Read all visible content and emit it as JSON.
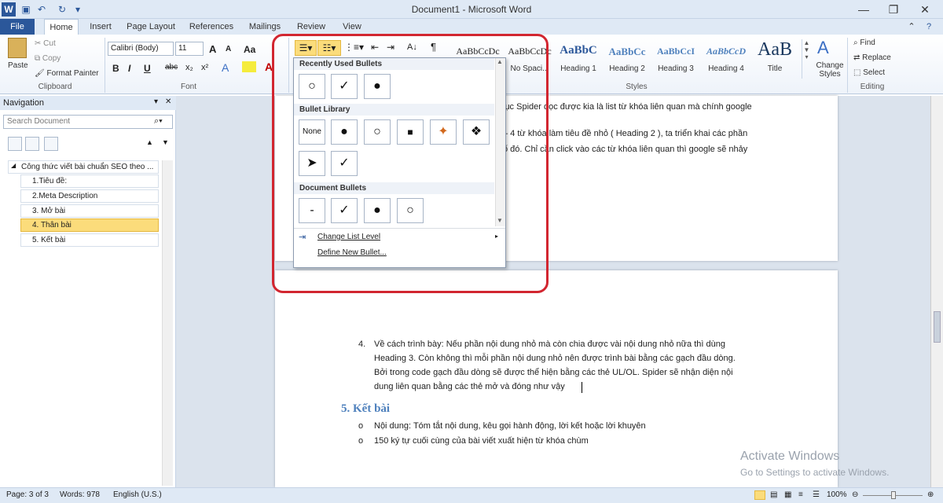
{
  "window": {
    "title": "Document1 - Microsoft Word"
  },
  "tabs": [
    "File",
    "Home",
    "Insert",
    "Page Layout",
    "References",
    "Mailings",
    "Review",
    "View"
  ],
  "clipboard": {
    "group_label": "Clipboard",
    "paste": "Paste",
    "cut": "Cut",
    "copy": "Copy",
    "format_painter": "Format Painter"
  },
  "font": {
    "group_label": "Font",
    "font_name": "Calibri (Body)",
    "font_size": "11",
    "bold": "B",
    "italic": "I",
    "underline": "U",
    "strike": "abc",
    "subscript": "x₂",
    "superscript": "x²",
    "aa": "Aa",
    "grow": "A",
    "shrink": "A"
  },
  "paragraph": {
    "pilcrow": "¶",
    "sort": "A↓"
  },
  "styles": {
    "group_label": "Styles",
    "items": [
      {
        "sample": "AaBbCcDc",
        "name": ""
      },
      {
        "sample": "AaBbCcDc",
        "name": "No Spaci..."
      },
      {
        "sample": "AaBbC",
        "name": "Heading 1"
      },
      {
        "sample": "AaBbCc",
        "name": "Heading 2"
      },
      {
        "sample": "AaBbCcI",
        "name": "Heading 3"
      },
      {
        "sample": "AaBbCcD",
        "name": "Heading 4"
      },
      {
        "sample": "AaB",
        "name": "Title"
      }
    ],
    "change_styles": "Change Styles"
  },
  "editing": {
    "group_label": "Editing",
    "find": "Find",
    "replace": "Replace",
    "select": "Select"
  },
  "navigation": {
    "title": "Navigation",
    "search_placeholder": "Search Document",
    "root": "Công thức viết bài chuẩn SEO theo ...",
    "items": [
      "1.Tiêu đề:",
      "2.Meta Description",
      "3. Mở bài",
      "4. Thân bài",
      "5. Kết bài"
    ],
    "selected_index": 3
  },
  "bullet_menu": {
    "recent_label": "Recently Used Bullets",
    "recent": [
      "○",
      "✓",
      "●"
    ],
    "library_label": "Bullet Library",
    "library": [
      "None",
      "●",
      "○",
      "■",
      "✦",
      "❖",
      "➤",
      "✓"
    ],
    "document_label": "Document Bullets",
    "document": [
      "-",
      "✓",
      "●",
      "○"
    ],
    "change_level": "Change List Level",
    "define_new": "Define New Bullet..."
  },
  "document": {
    "upper_line1": "lục Spider đọc được kia là list từ khóa liên quan mà chính google",
    "upper_line2": "– 4 từ khóa làm tiêu đề nhỏ ( Heading 2 ), ta triển khai các phần",
    "upper_line3": "ố đó. Chỉ cần click vào các từ khóa liên quan thì google sẽ nhảy",
    "item4_num": "4.",
    "item4_lines": [
      "Về cách trình bày: Nếu phần nội dung nhỏ mà còn chia được vài nội dung nhỏ nữa thì dùng",
      "Heading 3. Còn không thì mỗi phần nội dung nhỏ nên được trình bài bằng các gạch đầu dòng.",
      "Bởi trong code gạch đầu dòng sẽ được thể hiện bằng các thẻ UL/OL. Spider sẽ nhận diện nội",
      "dung liên quan bằng các thẻ mở và đóng như vậy"
    ],
    "heading5": "5. Kết bài",
    "bullets": [
      "Nội dung: Tóm tắt nội dung, kêu gọi hành động, lời kết hoặc lời khuyên",
      "150 ký tự cuối cùng của bài viết xuất hiện từ khóa chùm"
    ],
    "bullet_glyph": "o"
  },
  "watermark": {
    "line1": "Activate Windows",
    "line2": "Go to Settings to activate Windows."
  },
  "status": {
    "page": "Page: 3 of 3",
    "words": "Words: 978",
    "language": "English (U.S.)",
    "zoom": "100%"
  },
  "colors": {
    "accent": "#2b579a",
    "highlight_red": "#d22630",
    "selected_nav": "#fbdc7b"
  }
}
